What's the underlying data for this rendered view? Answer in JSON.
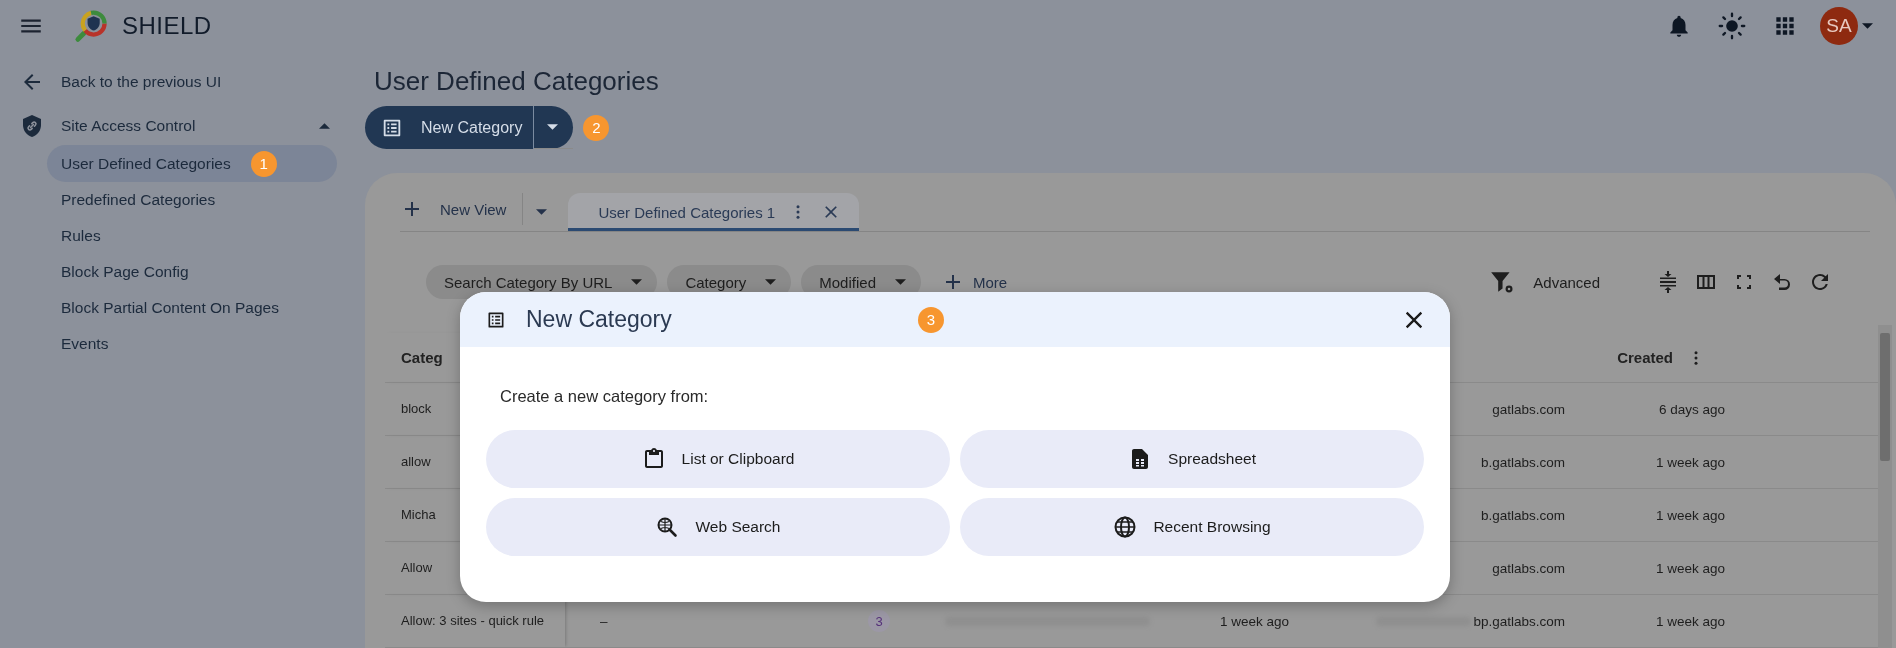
{
  "header": {
    "app_name": "SHIELD",
    "avatar_initials": "SA"
  },
  "sidebar": {
    "back_link": "Back to the previous UI",
    "section": {
      "label": "Site Access Control",
      "expanded": true,
      "items": [
        {
          "label": "User Defined Categories",
          "selected": true,
          "marker": "1"
        },
        {
          "label": "Predefined Categories",
          "selected": false
        },
        {
          "label": "Rules",
          "selected": false
        },
        {
          "label": "Block Page Config",
          "selected": false
        },
        {
          "label": "Block Partial Content On Pages",
          "selected": false
        },
        {
          "label": "Events",
          "selected": false
        }
      ]
    }
  },
  "page": {
    "title": "User Defined Categories",
    "new_button": {
      "label": "New Category",
      "marker": "2"
    }
  },
  "view_tabs": {
    "new_view": "New View",
    "tabs": [
      {
        "label": "User Defined Categories 1",
        "selected": true
      }
    ]
  },
  "filters": [
    {
      "label": "Search Category By URL"
    },
    {
      "label": "Category"
    },
    {
      "label": "Modified"
    }
  ],
  "more": "More",
  "advanced": "Advanced",
  "table": {
    "column_1": "Categ",
    "created_column": "Created",
    "rows": [
      {
        "name": "block",
        "column_6": "gatlabs.com",
        "created": "6 days ago"
      },
      {
        "name": "allow",
        "column_6": "b.gatlabs.com",
        "created": "1 week ago"
      },
      {
        "name": "Micha",
        "column_6": "b.gatlabs.com",
        "created": "1 week ago"
      },
      {
        "name": "Allow",
        "column_6": "gatlabs.com",
        "created": "1 week ago"
      },
      {
        "name": "Allow: 3 sites - quick rule",
        "column_2": "–",
        "count": "3",
        "column_4_blurred": true,
        "modified": "1 week ago",
        "column_6_blurred": true,
        "column_6": "bp.gatlabs.com",
        "created": "1 week ago"
      }
    ]
  },
  "dialog": {
    "title": "New Category",
    "marker": "3",
    "prompt": "Create a new category from:",
    "options": [
      {
        "label": "List or Clipboard",
        "kind": "clipboard"
      },
      {
        "label": "Spreadsheet",
        "kind": "spreadsheet"
      },
      {
        "label": "Web Search",
        "kind": "websearch"
      },
      {
        "label": "Recent Browsing",
        "kind": "globe"
      }
    ]
  }
}
